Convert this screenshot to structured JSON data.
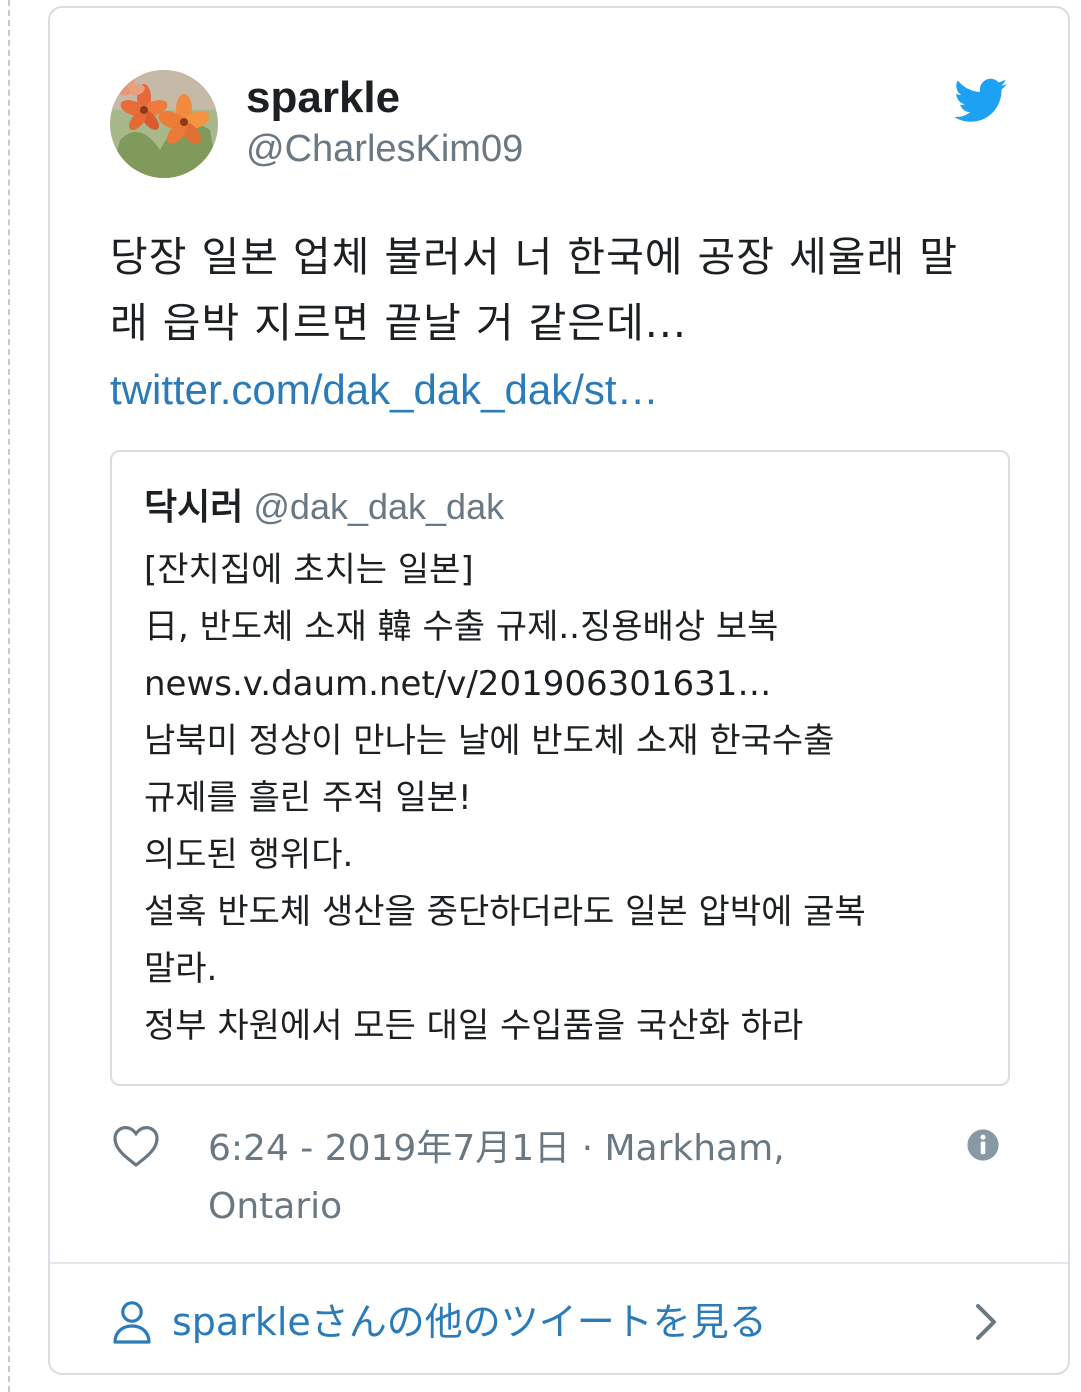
{
  "tweet": {
    "display_name": "sparkle",
    "handle": "@CharlesKim09",
    "text": "당장 일본 업체 불러서 너 한국에 공장 세울래 말\n래 읍박 지르면 끝날 거 같은데...",
    "link": "twitter.com/dak_dak_dak/st…",
    "timestamp_location": "6:24 - 2019年7月1日 · Markham, Ontario"
  },
  "quoted_tweet": {
    "display_name": "닥시러",
    "handle": "@dak_dak_dak",
    "lines": [
      "[잔치집에 초치는 일본]",
      "日, 반도체 소재 韓 수출 규제..징용배상 보복",
      "news.v.daum.net/v/201906301631…",
      "남북미 정상이 만나는 날에 반도체 소재 한국수출",
      "규제를 흘린 주적 일본!",
      "의도된 행위다.",
      "설혹 반도체 생산을 중단하더라도 일본 압박에 굴복",
      "말라.",
      "정부 차원에서 모든 대일 수입품을 국산화 하라"
    ]
  },
  "footer": {
    "more_tweets_label": "sparkleさんの他のツイートを見る"
  },
  "icons": {
    "brand": "twitter-bird-icon",
    "like": "heart-icon",
    "info": "info-icon",
    "profile": "person-icon",
    "chevron": "chevron-right-icon"
  },
  "colors": {
    "twitter_blue": "#1da1f2",
    "link_blue": "#2b7bb9",
    "text": "#1c2022",
    "muted": "#697882",
    "border": "#d9dde1"
  }
}
